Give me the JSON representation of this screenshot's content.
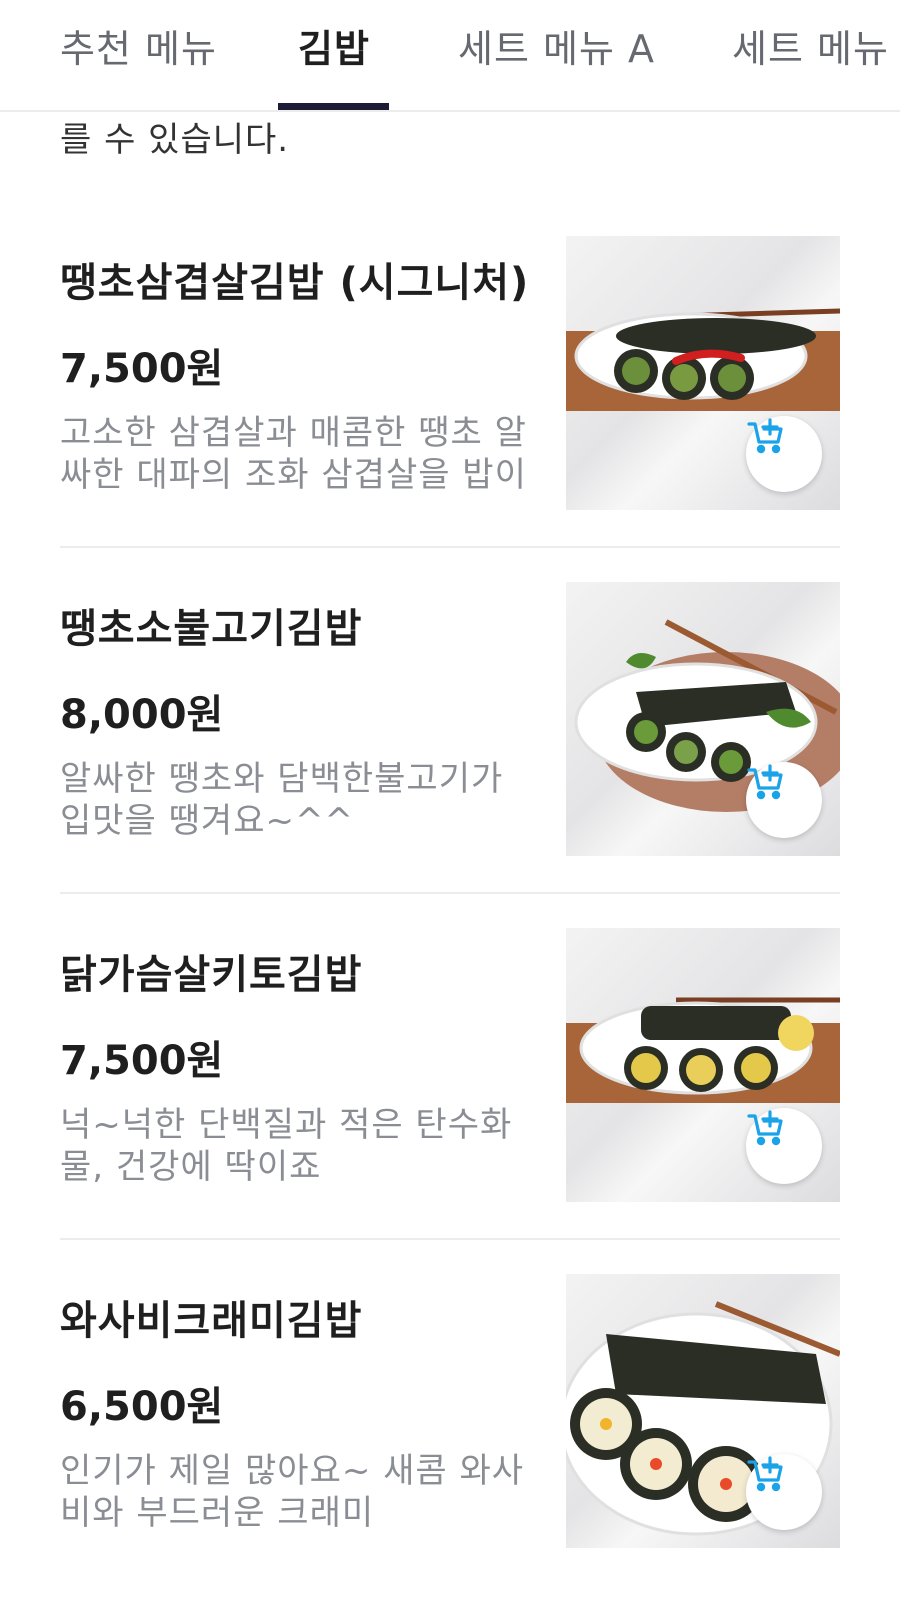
{
  "tabs": [
    {
      "label": "추천 메뉴"
    },
    {
      "label": "김밥",
      "active": true
    },
    {
      "label": "세트 메뉴 A"
    },
    {
      "label": "세트 메뉴"
    }
  ],
  "intro_text": "를 수 있습니다.",
  "items": [
    {
      "name": "땡초삼겹살김밥 (시그니처)",
      "price": "7,500원",
      "description": "고소한 삼겹살과 매콤한 땡초 알싸한 대파의 조화 삼겹살을 밥이",
      "image": "samgyeopsal-gimbap-photo"
    },
    {
      "name": "땡초소불고기김밥",
      "price": "8,000원",
      "description": "알싸한 땡초와 담백한불고기가 입맛을 땡겨요~^^",
      "image": "bulgogi-gimbap-photo"
    },
    {
      "name": "닭가슴살키토김밥",
      "price": "7,500원",
      "description": "넉~넉한 단백질과 적은 탄수화물, 건강에 딱이죠",
      "image": "chicken-keto-gimbap-photo"
    },
    {
      "name": "와사비크래미김밥",
      "price": "6,500원",
      "description": "인기가 제일 많아요~ 새콤 와사비와 부드러운 크래미",
      "image": "wasabi-crab-gimbap-photo"
    }
  ],
  "icons": {
    "cart_add": "cart-plus-icon"
  },
  "colors": {
    "accent": "#1b1d36",
    "cart_icon": "#1aa3e8",
    "desc_text": "#8a8d93"
  }
}
